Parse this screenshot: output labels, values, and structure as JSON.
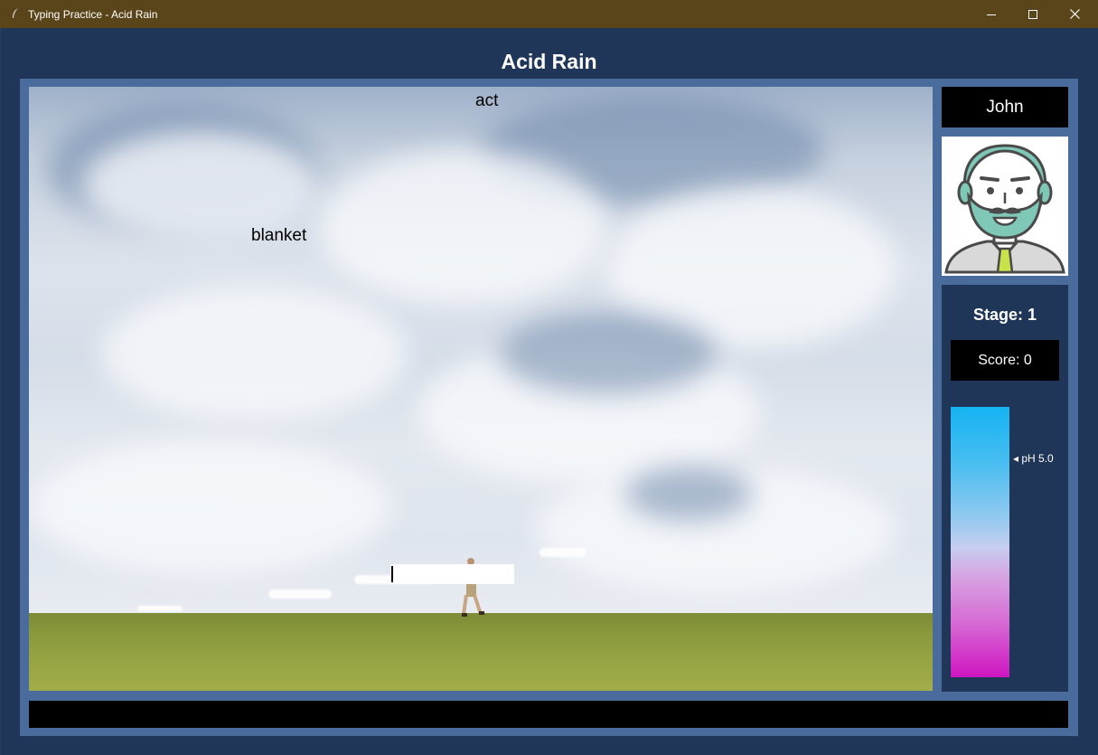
{
  "window": {
    "title": "Typing Practice - Acid Rain",
    "title_bar_color": "#5a4419"
  },
  "app": {
    "title": "Acid Rain",
    "background_color": "#1f3658",
    "frame_color": "#4a6c9c"
  },
  "falling_words": [
    {
      "text": "act"
    },
    {
      "text": "blanket"
    }
  ],
  "typing_input": {
    "value": ""
  },
  "player": {
    "name": "John",
    "avatar_icon": "bearded-man-avatar-icon"
  },
  "stats": {
    "stage": "Stage: 1",
    "score": "Score: 0"
  },
  "ph_meter": {
    "marker_label": "◂ pH 5.0",
    "top_color": "#15b3f2",
    "bottom_color": "#cf15c1"
  },
  "status_bar": {
    "text": ""
  }
}
